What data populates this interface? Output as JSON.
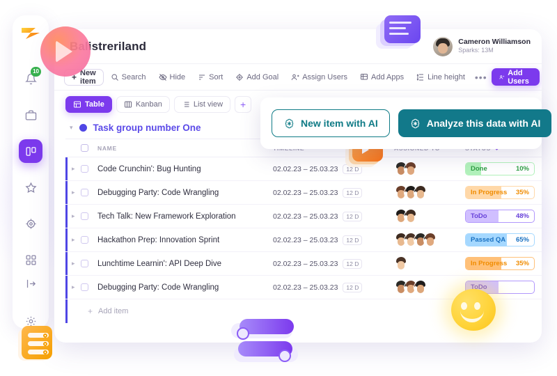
{
  "app": {
    "board_title": "Balistreriland",
    "logo_icon": "lightning-bolt-logo"
  },
  "user": {
    "name": "Cameron Williamson",
    "subtitle": "Sparks: 13M",
    "avatar_icon": "user-avatar"
  },
  "rail": {
    "notification_badge": "10",
    "items": [
      {
        "icon": "bell-icon",
        "name": "notifications",
        "active": false
      },
      {
        "icon": "briefcase-icon",
        "name": "workspace",
        "active": false
      },
      {
        "icon": "boards-icon",
        "name": "boards",
        "active": true
      },
      {
        "icon": "star-icon",
        "name": "favorites",
        "active": false
      },
      {
        "icon": "target-icon",
        "name": "goals",
        "active": false
      },
      {
        "icon": "grid-icon",
        "name": "apps",
        "active": false
      }
    ],
    "bottom_items": [
      {
        "icon": "logout-icon",
        "name": "collapse-sidebar"
      },
      {
        "icon": "gear-icon",
        "name": "settings"
      }
    ]
  },
  "toolbar": {
    "new_item_label": "New item",
    "items": [
      {
        "label": "Search",
        "icon": "search-icon"
      },
      {
        "label": "Hide",
        "icon": "eye-off-icon"
      },
      {
        "label": "Sort",
        "icon": "sort-icon"
      },
      {
        "label": "Add Goal",
        "icon": "target-icon"
      },
      {
        "label": "Assign Users",
        "icon": "user-plus-icon"
      },
      {
        "label": "Add Apps",
        "icon": "apps-icon"
      },
      {
        "label": "Line height",
        "icon": "line-height-icon"
      }
    ],
    "more_label": "•••",
    "add_users_label": "Add Users"
  },
  "views": {
    "tabs": [
      {
        "label": "Table",
        "icon": "table-icon",
        "active": true
      },
      {
        "label": "Kanban",
        "icon": "kanban-icon",
        "active": false
      },
      {
        "label": "List view",
        "icon": "list-icon",
        "active": false
      }
    ],
    "add_label": "+"
  },
  "group": {
    "name": "Task group number One",
    "collapse_icon": "chevron-down-icon",
    "dot_color": "#4f46e5"
  },
  "table": {
    "columns": [
      "NAME",
      "TIMELINE",
      "ASSIGNED TO",
      "STATUS"
    ],
    "status_sort_icon": "sort-arrows-icon",
    "add_item_label": "Add item",
    "rows": [
      {
        "name": "Code Crunchin': Bug Hunting",
        "timeline": "02.02.23 – 25.03.23",
        "duration": "12 D",
        "assignees": 2,
        "status": "Done",
        "percent": "10%",
        "fill": 22,
        "color": "#2f9e44",
        "bg": "#b2f2bb",
        "border": "#b2f2bb"
      },
      {
        "name": "Debugging Party: Code Wrangling",
        "timeline": "02.02.23 – 25.03.23",
        "duration": "12 D",
        "assignees": 3,
        "status": "In Progress",
        "percent": "35%",
        "fill": 52,
        "color": "#f08c00",
        "bg": "#ffd8a8",
        "border": "#ffd8a8"
      },
      {
        "name": "Tech Talk: New Framework Exploration",
        "timeline": "02.02.23 – 25.03.23",
        "duration": "12 D",
        "assignees": 2,
        "status": "ToDo",
        "percent": "48%",
        "fill": 48,
        "color": "#6741d9",
        "bg": "#d0bfff",
        "border": "#b197fc"
      },
      {
        "name": "Hackathon Prep: Innovation Sprint",
        "timeline": "02.02.23 – 25.03.23",
        "duration": "12 D",
        "assignees": 4,
        "status": "Passed QA",
        "percent": "65%",
        "fill": 60,
        "color": "#1971c2",
        "bg": "#a5d8ff",
        "border": "#a5d8ff"
      },
      {
        "name": "Lunchtime Learnin': API Deep Dive",
        "timeline": "02.02.23 – 25.03.23",
        "duration": "12 D",
        "assignees": 1,
        "status": "In Progress",
        "percent": "35%",
        "fill": 52,
        "color": "#f08c00",
        "bg": "#ffc078",
        "border": "#ffc078"
      },
      {
        "name": "Debugging Party: Code Wrangling",
        "timeline": "02.02.23 – 25.03.23",
        "duration": "12 D",
        "assignees": 3,
        "status": "ToDo",
        "percent": "",
        "fill": 48,
        "color": "#6741d9",
        "bg": "#d0bfff",
        "border": "#b197fc"
      }
    ]
  },
  "ai_popup": {
    "new_item_label": "New item with AI",
    "analyze_label": "Analyze this data with AI",
    "icon": "openai-icon",
    "accent": "#12798a"
  }
}
